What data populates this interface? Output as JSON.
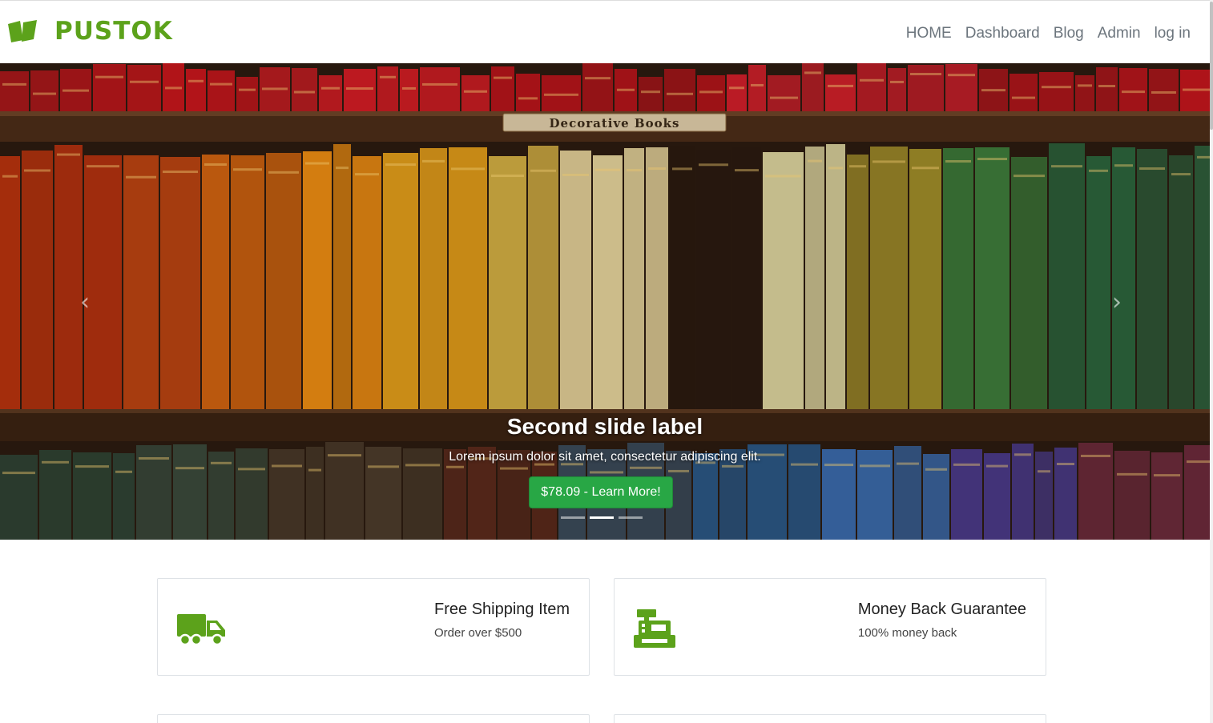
{
  "brand": {
    "name": "PUSTOK",
    "icon": "book-icon",
    "color": "#5ca21b"
  },
  "nav": {
    "items": [
      "HOME",
      "Dashboard",
      "Blog",
      "Admin",
      "log in"
    ]
  },
  "carousel": {
    "sign_text": "Decorative Books",
    "slide_title": "Second slide label",
    "slide_text": "Lorem ipsum dolor sit amet, consectetur adipiscing elit.",
    "button_label": "$78.09 - Learn More!",
    "button_color": "#28a745",
    "slide_count": 3,
    "active_slide": 2,
    "prev_icon": "chevron-left-icon",
    "next_icon": "chevron-right-icon"
  },
  "features": [
    {
      "title": "Free Shipping Item",
      "subtitle": "Order over $500",
      "icon": "truck-icon"
    },
    {
      "title": "Money Back Guarantee",
      "subtitle": "100% money back",
      "icon": "cash-register-icon"
    }
  ],
  "colors": {
    "accent": "#5ca21b",
    "nav_text": "#6c757d"
  }
}
